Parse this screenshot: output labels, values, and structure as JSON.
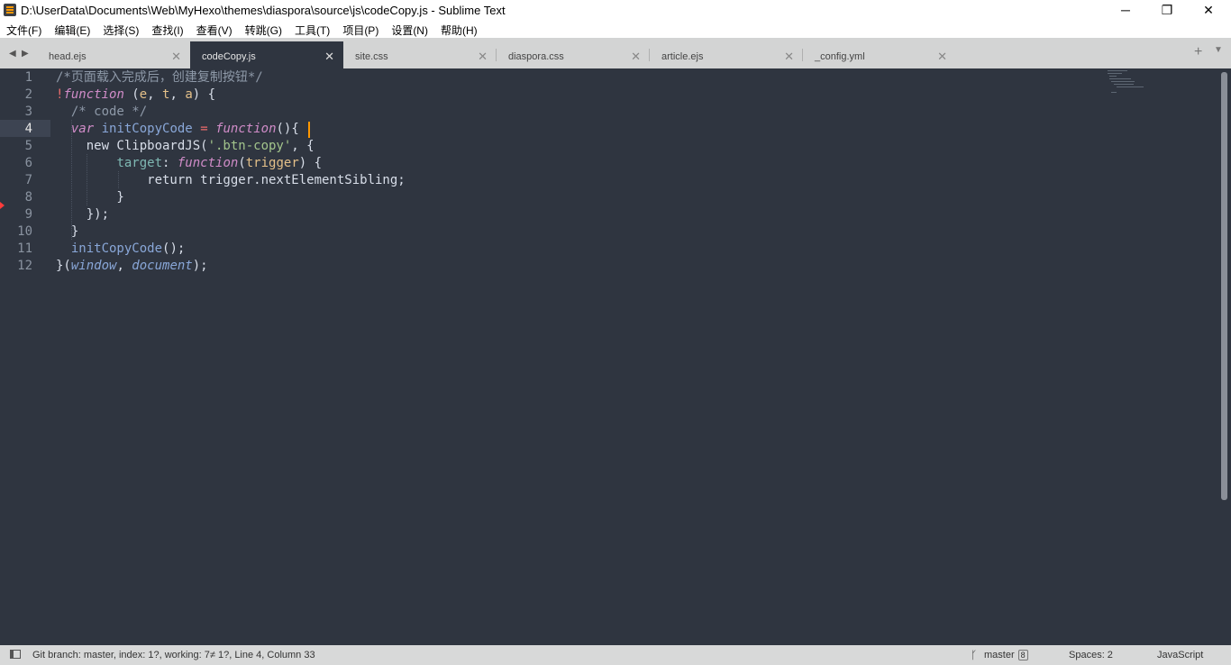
{
  "window": {
    "title": "D:\\UserData\\Documents\\Web\\MyHexo\\themes\\diaspora\\source\\js\\codeCopy.js - Sublime Text",
    "controls": {
      "minimize": "─",
      "restore": "❐",
      "close": "✕"
    }
  },
  "menu": [
    "文件(F)",
    "编辑(E)",
    "选择(S)",
    "查找(I)",
    "查看(V)",
    "转跳(G)",
    "工具(T)",
    "项目(P)",
    "设置(N)",
    "帮助(H)"
  ],
  "tabs": [
    {
      "label": "head.ejs",
      "active": false
    },
    {
      "label": "codeCopy.js",
      "active": true
    },
    {
      "label": "site.css",
      "active": false
    },
    {
      "label": "diaspora.css",
      "active": false
    },
    {
      "label": "article.ejs",
      "active": false
    },
    {
      "label": "_config.yml",
      "active": false
    }
  ],
  "tab_close_glyph": "✕",
  "tab_nav": {
    "left": "◀",
    "right": "▶",
    "add": "+",
    "menu": "▼"
  },
  "editor": {
    "line_numbers": [
      "1",
      "2",
      "3",
      "4",
      "5",
      "6",
      "7",
      "8",
      "9",
      "10",
      "11",
      "12"
    ],
    "current_line": "4",
    "lines": [
      "/*页面载入完成后，创建复制按钮*/",
      "!function (e, t, a) {",
      "  /* code */",
      "  var initCopyCode = function(){",
      "    new ClipboardJS('.btn-copy', {",
      "        target: function(trigger) {",
      "            return trigger.nextElementSibling;",
      "        }",
      "    });",
      "  }",
      "  initCopyCode();",
      "}(window, document);"
    ]
  },
  "status": {
    "git_info": "Git branch: master, index: 1?, working: 7≠ 1?, Line 4, Column 33",
    "branch": "master",
    "branch_count": "8",
    "spaces": "Spaces: 2",
    "syntax": "JavaScript"
  },
  "colors": {
    "editor_bg": "#2f3540",
    "caret": "#ff9800",
    "keyword": "#d08cc8",
    "string": "#a3c58c",
    "comment": "#8e99a8"
  }
}
